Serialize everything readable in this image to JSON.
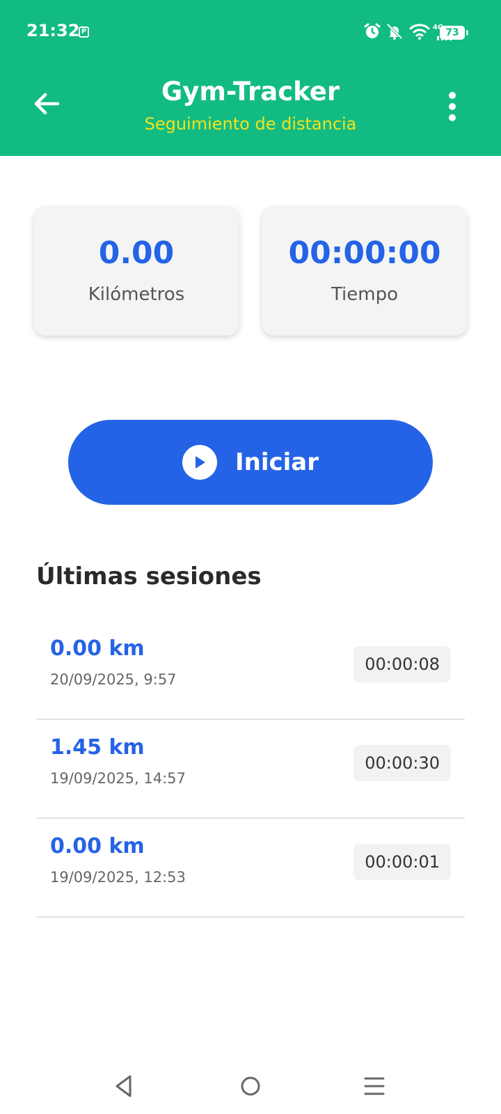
{
  "status_bar": {
    "time": "21:32",
    "notification_icon": "parking-icon",
    "icons": [
      "alarm-icon",
      "muted-bell-icon",
      "wifi-icon",
      "4g-signal-icon"
    ],
    "network_label": "4G",
    "battery": "73"
  },
  "app_bar": {
    "title": "Gym-Tracker",
    "subtitle": "Seguimiento de distancia",
    "back_icon": "arrow-back-icon",
    "menu_icon": "more-vert-icon"
  },
  "stats": {
    "distance": {
      "value": "0.00",
      "label": "Kilómetros"
    },
    "time": {
      "value": "00:00:00",
      "label": "Tiempo"
    }
  },
  "start_button": {
    "label": "Iniciar",
    "icon": "play-icon"
  },
  "sessions": {
    "title": "Últimas sesiones",
    "items": [
      {
        "distance": "0.00 km",
        "date": "20/09/2025, 9:57",
        "duration": "00:00:08"
      },
      {
        "distance": "1.45 km",
        "date": "19/09/2025, 14:57",
        "duration": "00:00:30"
      },
      {
        "distance": "0.00 km",
        "date": "19/09/2025, 12:53",
        "duration": "00:00:01"
      }
    ]
  },
  "nav_bar": {
    "buttons": [
      "back-triangle-icon",
      "home-circle-icon",
      "recents-menu-icon"
    ]
  },
  "colors": {
    "header": "#12bb82",
    "subtitle": "#f3e21c",
    "accent": "#2563e6",
    "card": "#f4f4f4"
  }
}
